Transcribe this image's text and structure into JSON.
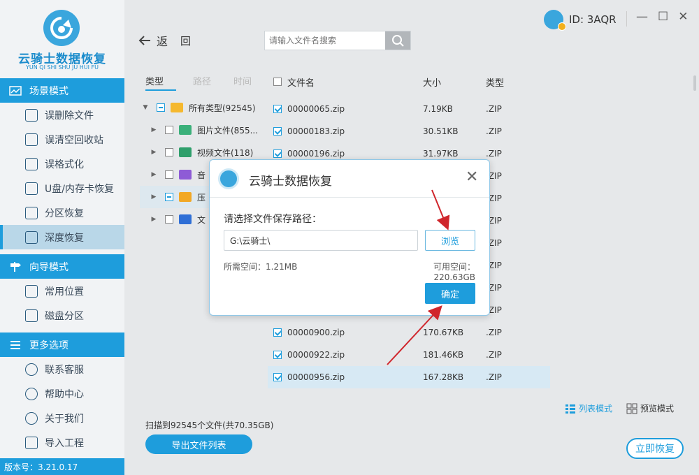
{
  "app": {
    "name": "云骑士数据恢复",
    "name_pinyin": "YUN QI SHI SHU JU HUI FU",
    "version": "版本号：3.21.0.17",
    "user_id": "ID: 3AQR"
  },
  "sidebar": {
    "sections": [
      {
        "title": "场景模式",
        "items": [
          "误删除文件",
          "误清空回收站",
          "误格式化",
          "U盘/内存卡恢复",
          "分区恢复",
          "深度恢复"
        ]
      },
      {
        "title": "向导模式",
        "items": [
          "常用位置",
          "磁盘分区"
        ]
      },
      {
        "title": "更多选项",
        "items": [
          "联系客服",
          "帮助中心",
          "关于我们",
          "导入工程"
        ]
      }
    ]
  },
  "toolbar": {
    "back_label": "返",
    "back2_label": "回",
    "search_placeholder": "请输入文件名搜索"
  },
  "tabs": [
    "类型",
    "路径",
    "时间"
  ],
  "tree": [
    {
      "label": "所有类型(92545)",
      "level": 0
    },
    {
      "label": "图片文件(855...",
      "level": 1
    },
    {
      "label": "视频文件(118)",
      "level": 1
    },
    {
      "label": "音",
      "level": 1
    },
    {
      "label": "压",
      "level": 1
    },
    {
      "label": "文",
      "level": 1
    }
  ],
  "list": {
    "headers": {
      "name": "文件名",
      "size": "大小",
      "type": "类型"
    },
    "rows": [
      {
        "name": "00000065.zip",
        "size": "7.19KB",
        "type": ".ZIP"
      },
      {
        "name": "00000183.zip",
        "size": "30.51KB",
        "type": ".ZIP"
      },
      {
        "name": "00000196.zip",
        "size": "31.97KB",
        "type": ".ZIP"
      },
      {
        "name": "",
        "size": "",
        "type": ".ZIP"
      },
      {
        "name": "",
        "size": "",
        "type": ".ZIP"
      },
      {
        "name": "",
        "size": "",
        "type": ".ZIP"
      },
      {
        "name": "",
        "size": "",
        "type": ".ZIP"
      },
      {
        "name": "",
        "size": "",
        "type": ".ZIP"
      },
      {
        "name": "",
        "size": "",
        "type": ".ZIP"
      },
      {
        "name": "",
        "size": "",
        "type": ".ZIP"
      },
      {
        "name": "00000900.zip",
        "size": "170.67KB",
        "type": ".ZIP"
      },
      {
        "name": "00000922.zip",
        "size": "181.46KB",
        "type": ".ZIP"
      },
      {
        "name": "00000956.zip",
        "size": "167.28KB",
        "type": ".ZIP"
      }
    ]
  },
  "view_modes": {
    "list": "列表模式",
    "preview": "预览模式"
  },
  "status": {
    "scan_text": "扫描到92545个文件(共70.35GB)"
  },
  "buttons": {
    "export": "导出文件列表",
    "recover": "立即恢复"
  },
  "modal": {
    "title": "云骑士数据恢复",
    "label": "请选择文件保存路径：",
    "path": "G:\\云骑士\\",
    "browse": "浏览",
    "need_space": "所需空间：1.21MB",
    "avail_space": "可用空间：220.63GB",
    "ok": "确定"
  },
  "colors": {
    "accent": "#1e9ddc",
    "arrow": "#d0262c"
  }
}
